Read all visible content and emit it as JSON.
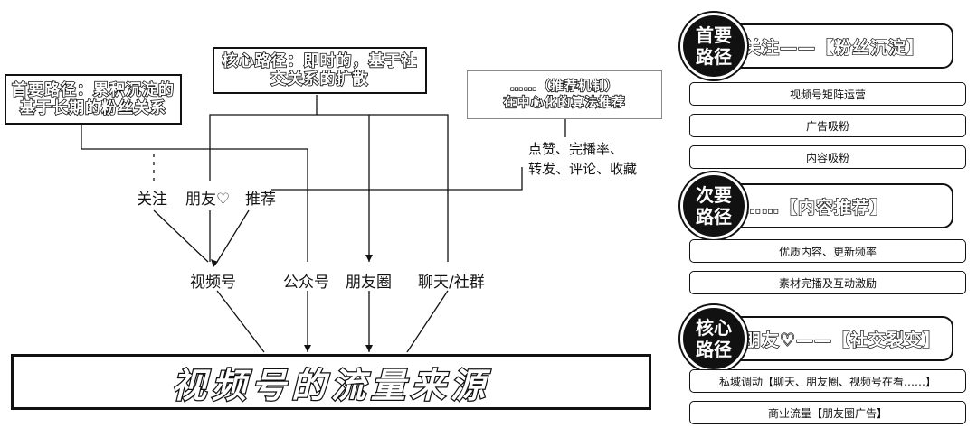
{
  "main_title": "视频号的流量来源",
  "notes": {
    "left": "首要路径：累积沉淀的基于长期的粉丝关系",
    "center": "核心路径：即时的，基于社交关系的扩散",
    "right_line1": "……（推荐机制）",
    "right_line2": "在中心化的算法推荐"
  },
  "metrics": {
    "line1": "点赞、完播率、",
    "line2": "转发、评论、收藏"
  },
  "entry_labels": {
    "follow": "关注",
    "friends": "朋友♡",
    "recommend": "推荐"
  },
  "sources": {
    "channels": "视频号",
    "official": "公众号",
    "moments": "朋友圈",
    "chat": "聊天/社群"
  },
  "paths": [
    {
      "badge": "首要路径",
      "banner": "关注——【粉丝沉淀】",
      "items": [
        "视频号矩阵运营",
        "广告吸粉",
        "内容吸粉"
      ]
    },
    {
      "badge": "次要路径",
      "banner": "……【内容推荐】",
      "items": [
        "优质内容、更新频率",
        "素材完播及互动激励"
      ]
    },
    {
      "badge": "核心路径",
      "banner": "朋友♡——【社交裂变】",
      "items": [
        "私域调动【聊天、朋友圈、视频号在看……】",
        "商业流量【朋友圈广告】"
      ]
    }
  ]
}
